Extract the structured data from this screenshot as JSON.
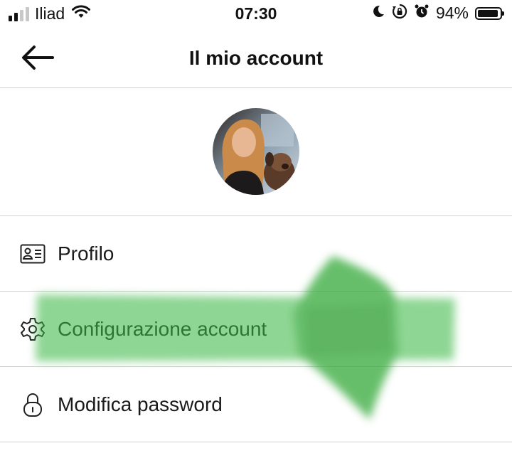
{
  "status_bar": {
    "carrier": "Iliad",
    "time": "07:30",
    "battery_percent": "94%",
    "battery_level": 0.94,
    "signal_bars_active": 2,
    "signal_bars_total": 4,
    "icons": [
      "wifi-icon",
      "moon-icon",
      "orientation-lock-icon",
      "alarm-icon",
      "battery-icon"
    ]
  },
  "header": {
    "title": "Il mio account",
    "back_icon": "arrow-left-icon"
  },
  "avatar": {
    "icon": "profile-photo"
  },
  "menu": {
    "items": [
      {
        "label": "Profilo",
        "icon": "id-card-icon"
      },
      {
        "label": "Configurazione account",
        "icon": "gear-icon"
      },
      {
        "label": "Modifica password",
        "icon": "lock-icon"
      }
    ]
  },
  "colors": {
    "highlight_marker": "#3fb845",
    "divider": "#d0d0d0",
    "text": "#111111"
  }
}
